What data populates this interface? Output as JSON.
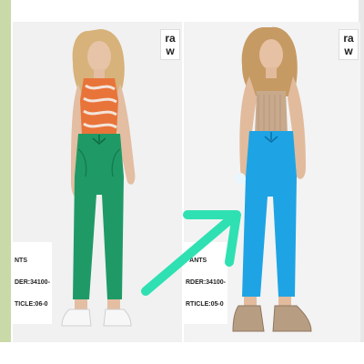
{
  "panels": [
    {
      "logo": "ra\nw",
      "caption_lines": [
        "NTS",
        "DER:34100-",
        "TICLE:06-0"
      ],
      "pants_color": "#1f9a66",
      "top_color": "#e8743a"
    },
    {
      "logo": "ra\nw",
      "caption_lines": [
        "PANTS",
        "RDER:34100-",
        "RTICLE:05-0"
      ],
      "pants_color": "#1ea4e4",
      "top_color": "#c8a98c"
    }
  ],
  "arrow_color": "#2fe0b2"
}
